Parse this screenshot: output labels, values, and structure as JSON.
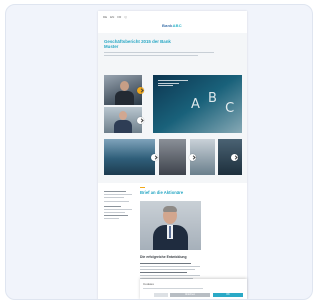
{
  "page": {
    "nav": [
      "DE",
      "EN",
      "FR",
      "Q"
    ],
    "logo_main": "Bank",
    "logo_accent": "ABC"
  },
  "hero": {
    "title": "Geschäftsbericht 2015 der Bank Muster"
  },
  "mosaic": {
    "letters": [
      "A",
      "B",
      "C"
    ]
  },
  "section": {
    "title": "Brief an die Aktionäre",
    "subtitle": "Die erfolgreiche Entwicklung"
  },
  "cookie": {
    "title": "Cookies",
    "decline": "Ablehnen",
    "accept": "OK"
  },
  "colors": {
    "accent": "#27a7c4",
    "highlight": "#f2a91b",
    "background": "#f1f4fb"
  }
}
